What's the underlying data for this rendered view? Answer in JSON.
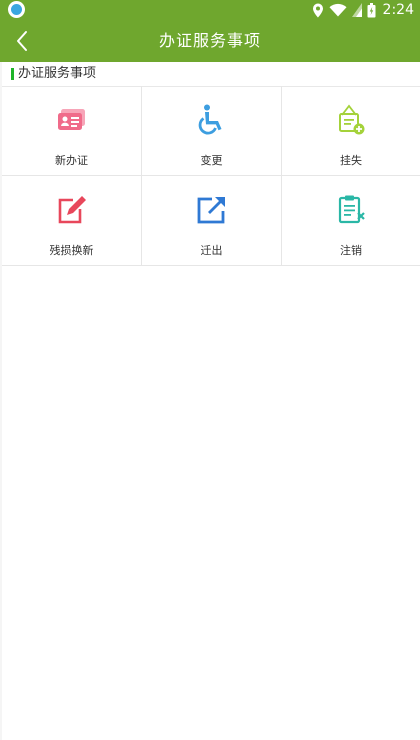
{
  "status_bar": {
    "time": "2:24",
    "icons": [
      "app-badge-icon",
      "location-icon",
      "wifi-icon",
      "signal-icon",
      "battery-icon"
    ]
  },
  "app_bar": {
    "title": "办证服务事项",
    "back_icon": "chevron-left-icon"
  },
  "section": {
    "title": "办证服务事项"
  },
  "services": [
    {
      "label": "新办证",
      "icon": "id-card-icon",
      "color": "#f06b8a"
    },
    {
      "label": "变更",
      "icon": "wheelchair-icon",
      "color": "#3d9ee0"
    },
    {
      "label": "挂失",
      "icon": "hanging-sign-icon",
      "color": "#a4d23a"
    },
    {
      "label": "残损换新",
      "icon": "edit-icon",
      "color": "#e8475b"
    },
    {
      "label": "迁出",
      "icon": "export-icon",
      "color": "#2f79d4"
    },
    {
      "label": "注销",
      "icon": "clipboard-cancel-icon",
      "color": "#2ab7a6"
    }
  ],
  "colors": {
    "primary": "#6fa72e",
    "section_marker": "#1fb52a"
  }
}
